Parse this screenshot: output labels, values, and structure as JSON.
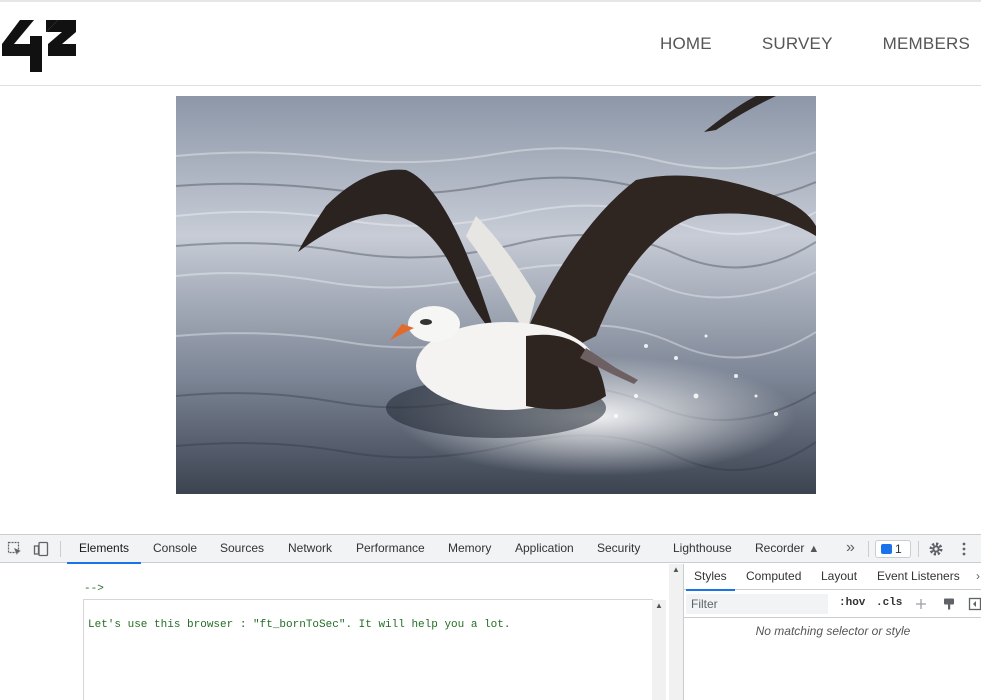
{
  "site": {
    "logo_text": "42",
    "nav": [
      {
        "label": "HOME"
      },
      {
        "label": "SURVEY"
      },
      {
        "label": "MEMBERS"
      }
    ]
  },
  "hero": {
    "image_subject": "albatross landing on water"
  },
  "devtools": {
    "tabs": [
      {
        "label": "Elements",
        "active": true
      },
      {
        "label": "Console"
      },
      {
        "label": "Sources"
      },
      {
        "label": "Network"
      },
      {
        "label": "Performance"
      },
      {
        "label": "Memory"
      },
      {
        "label": "Application"
      },
      {
        "label": "Security"
      },
      {
        "label": "Lighthouse"
      },
      {
        "label": "Recorder"
      }
    ],
    "more_tabs_glyph": "»",
    "issues_count": "1",
    "elements": {
      "comment_close": "-->",
      "comment_text": "Let's use this browser : \"ft_bornToSec\". It will help you a lot."
    },
    "styles_pane": {
      "tabs": [
        {
          "label": "Styles",
          "active": true
        },
        {
          "label": "Computed"
        },
        {
          "label": "Layout"
        },
        {
          "label": "Event Listeners"
        }
      ],
      "filter_placeholder": "Filter",
      "hov_label": ":hov",
      "cls_label": ".cls",
      "no_match_text": "No matching selector or style"
    },
    "colors": {
      "accent": "#1a73e8",
      "comment_green": "#236e25",
      "toolbar_bg": "#f1f3f4"
    }
  }
}
